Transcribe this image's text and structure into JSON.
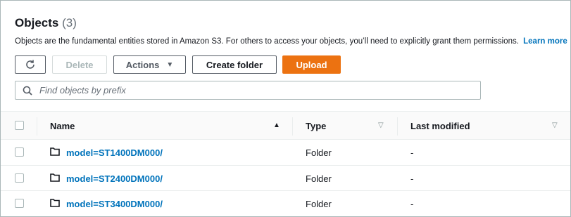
{
  "header": {
    "title": "Objects",
    "count": "(3)",
    "description": "Objects are the fundamental entities stored in Amazon S3. For others to access your objects, you’ll need to explicitly grant them permissions.",
    "learn_more": "Learn more"
  },
  "toolbar": {
    "refresh_icon": "refresh-icon",
    "delete_label": "Delete",
    "actions_label": "Actions",
    "create_folder_label": "Create folder",
    "upload_label": "Upload",
    "accent_color": "#ec7211"
  },
  "search": {
    "placeholder": "Find objects by prefix",
    "value": ""
  },
  "table": {
    "columns": {
      "name": "Name",
      "type": "Type",
      "last_modified": "Last modified"
    },
    "rows": [
      {
        "name": "model=ST1400DM000/",
        "type": "Folder",
        "last_modified": "-"
      },
      {
        "name": "model=ST2400DM000/",
        "type": "Folder",
        "last_modified": "-"
      },
      {
        "name": "model=ST3400DM000/",
        "type": "Folder",
        "last_modified": "-"
      }
    ]
  },
  "colors": {
    "link": "#0073bb",
    "border": "#aab7b8"
  }
}
